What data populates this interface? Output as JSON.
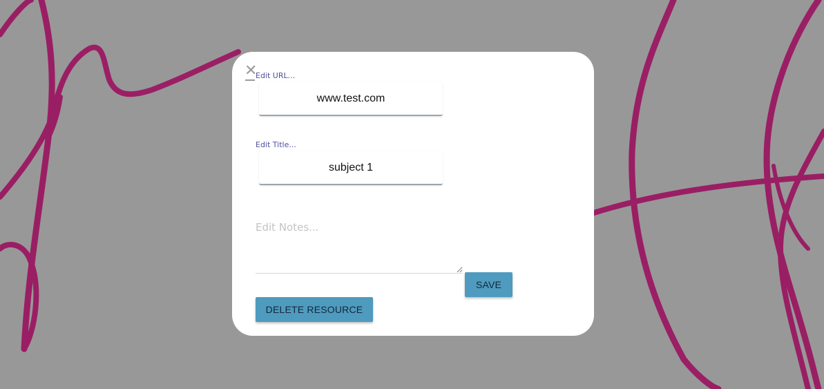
{
  "modal": {
    "close_icon": "close-icon",
    "url_label": "Edit URL...",
    "url_value": "www.test.com",
    "title_label": "Edit Title...",
    "title_value": "subject 1",
    "notes_placeholder": "Edit Notes...",
    "notes_value": "",
    "save_label": "SAVE",
    "delete_label": "DELETE RESOURCE"
  },
  "colors": {
    "backdrop": "#989898",
    "brush_stroke": "#9b1862",
    "button": "#4f9bbf",
    "label": "#4f4f9f"
  }
}
